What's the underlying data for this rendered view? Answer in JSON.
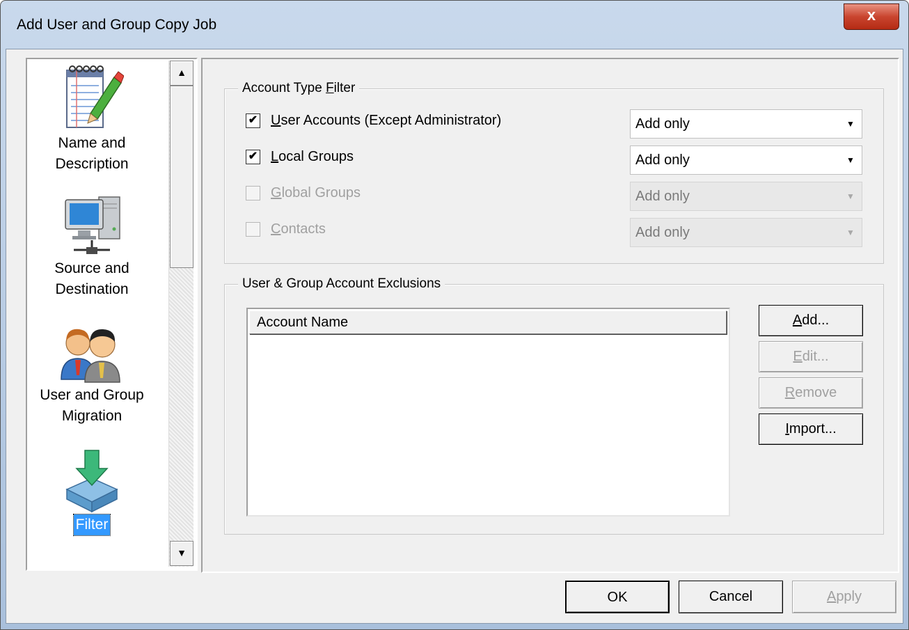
{
  "window": {
    "title": "Add User and Group Copy Job",
    "close_label": "x"
  },
  "nav": {
    "items": [
      {
        "label_line1": "Name and",
        "label_line2": "Description",
        "icon": "notepad-pencil-icon"
      },
      {
        "label_line1": "Source and",
        "label_line2": "Destination",
        "icon": "computer-network-icon"
      },
      {
        "label_line1": "User and Group",
        "label_line2": "Migration",
        "icon": "users-icon"
      },
      {
        "label_line1": "Filter",
        "label_line2": "",
        "icon": "filter-download-icon",
        "selected": true
      }
    ],
    "scroll_up": "▲",
    "scroll_down": "▼"
  },
  "account_type_filter": {
    "legend_pre": "Account Type ",
    "legend_u": "F",
    "legend_post": "ilter",
    "rows": [
      {
        "label_u": "U",
        "label_rest": "ser Accounts (Except Administrator)",
        "checked": true,
        "enabled": true,
        "combo_value": "Add only"
      },
      {
        "label_u": "L",
        "label_rest": "ocal Groups",
        "checked": true,
        "enabled": true,
        "combo_value": "Add only"
      },
      {
        "label_u": "G",
        "label_rest": "lobal Groups",
        "checked": false,
        "enabled": false,
        "combo_value": "Add only"
      },
      {
        "label_u": "C",
        "label_rest": "ontacts",
        "checked": false,
        "enabled": false,
        "combo_value": "Add only"
      }
    ],
    "check_mark": "✔",
    "dropdown_arrow": "▼"
  },
  "exclusions": {
    "legend": "User & Group Account Exclusions",
    "column_header": "Account Name",
    "rows": [],
    "buttons": [
      {
        "u": "A",
        "rest": "dd...",
        "enabled": true
      },
      {
        "u": "E",
        "rest": "dit...",
        "enabled": false
      },
      {
        "u": "R",
        "rest": "emove",
        "enabled": false
      },
      {
        "u": "I",
        "rest": "mport...",
        "enabled": true
      }
    ]
  },
  "footer": {
    "ok_label": "OK",
    "cancel_label": "Cancel",
    "apply_u": "A",
    "apply_rest": "pply"
  },
  "colors": {
    "selection": "#3399ff",
    "dialog_bg": "#f0f0f0",
    "close_button": "#c9452f"
  }
}
